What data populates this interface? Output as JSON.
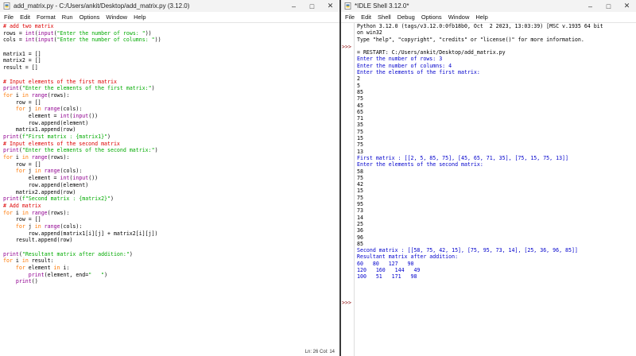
{
  "editor": {
    "title": "add_matrix.py - C:/Users/ankit/Desktop/add_matrix.py (3.12.0)",
    "menu": [
      "File",
      "Edit",
      "Format",
      "Run",
      "Options",
      "Window",
      "Help"
    ],
    "code_lines": [
      [
        [
          "cm",
          "# add two matrix"
        ]
      ],
      [
        [
          "df",
          "rows = "
        ],
        [
          "bi",
          "int"
        ],
        [
          "df",
          "("
        ],
        [
          "bi",
          "input"
        ],
        [
          "df",
          "("
        ],
        [
          "st",
          "\"Enter the number of rows: \""
        ],
        [
          "df",
          "))"
        ]
      ],
      [
        [
          "df",
          "cols = "
        ],
        [
          "bi",
          "int"
        ],
        [
          "df",
          "("
        ],
        [
          "bi",
          "input"
        ],
        [
          "df",
          "("
        ],
        [
          "st",
          "\"Enter the number of columns: \""
        ],
        [
          "df",
          "))"
        ]
      ],
      [
        [
          "df",
          ""
        ]
      ],
      [
        [
          "df",
          "matrix1 = []"
        ]
      ],
      [
        [
          "df",
          "matrix2 = []"
        ]
      ],
      [
        [
          "df",
          "result = []"
        ]
      ],
      [
        [
          "df",
          ""
        ]
      ],
      [
        [
          "cm",
          "# Input elements of the first matrix"
        ]
      ],
      [
        [
          "bi",
          "print"
        ],
        [
          "df",
          "("
        ],
        [
          "st",
          "\"Enter the elements of the first matrix:\""
        ],
        [
          "df",
          ")"
        ]
      ],
      [
        [
          "kw",
          "for"
        ],
        [
          "df",
          " i "
        ],
        [
          "kw",
          "in"
        ],
        [
          "df",
          " "
        ],
        [
          "bi",
          "range"
        ],
        [
          "df",
          "(rows):"
        ]
      ],
      [
        [
          "df",
          "    row = []"
        ]
      ],
      [
        [
          "df",
          "    "
        ],
        [
          "kw",
          "for"
        ],
        [
          "df",
          " j "
        ],
        [
          "kw",
          "in"
        ],
        [
          "df",
          " "
        ],
        [
          "bi",
          "range"
        ],
        [
          "df",
          "(cols):"
        ]
      ],
      [
        [
          "df",
          "        element = "
        ],
        [
          "bi",
          "int"
        ],
        [
          "df",
          "("
        ],
        [
          "bi",
          "input"
        ],
        [
          "df",
          "())"
        ]
      ],
      [
        [
          "df",
          "        row.append(element)"
        ]
      ],
      [
        [
          "df",
          "    matrix1.append(row)"
        ]
      ],
      [
        [
          "bi",
          "print"
        ],
        [
          "df",
          "("
        ],
        [
          "st",
          "f\"First matrix : {matrix1}\""
        ],
        [
          "df",
          ")"
        ]
      ],
      [
        [
          "cm",
          "# Input elements of the second matrix"
        ]
      ],
      [
        [
          "bi",
          "print"
        ],
        [
          "df",
          "("
        ],
        [
          "st",
          "\"Enter the elements of the second matrix:\""
        ],
        [
          "df",
          ")"
        ]
      ],
      [
        [
          "kw",
          "for"
        ],
        [
          "df",
          " i "
        ],
        [
          "kw",
          "in"
        ],
        [
          "df",
          " "
        ],
        [
          "bi",
          "range"
        ],
        [
          "df",
          "(rows):"
        ]
      ],
      [
        [
          "df",
          "    row = []"
        ]
      ],
      [
        [
          "df",
          "    "
        ],
        [
          "kw",
          "for"
        ],
        [
          "df",
          " j "
        ],
        [
          "kw",
          "in"
        ],
        [
          "df",
          " "
        ],
        [
          "bi",
          "range"
        ],
        [
          "df",
          "(cols):"
        ]
      ],
      [
        [
          "df",
          "        element = "
        ],
        [
          "bi",
          "int"
        ],
        [
          "df",
          "("
        ],
        [
          "bi",
          "input"
        ],
        [
          "df",
          "())"
        ]
      ],
      [
        [
          "df",
          "        row.append(element)"
        ]
      ],
      [
        [
          "df",
          "    matrix2.append(row)"
        ]
      ],
      [
        [
          "bi",
          "print"
        ],
        [
          "df",
          "("
        ],
        [
          "st",
          "f\"Second matrix : {matrix2}\""
        ],
        [
          "df",
          ")"
        ]
      ],
      [
        [
          "cm",
          "# Add matrix"
        ]
      ],
      [
        [
          "kw",
          "for"
        ],
        [
          "df",
          " i "
        ],
        [
          "kw",
          "in"
        ],
        [
          "df",
          " "
        ],
        [
          "bi",
          "range"
        ],
        [
          "df",
          "(rows):"
        ]
      ],
      [
        [
          "df",
          "    row = []"
        ]
      ],
      [
        [
          "df",
          "    "
        ],
        [
          "kw",
          "for"
        ],
        [
          "df",
          " j "
        ],
        [
          "kw",
          "in"
        ],
        [
          "df",
          " "
        ],
        [
          "bi",
          "range"
        ],
        [
          "df",
          "(cols):"
        ]
      ],
      [
        [
          "df",
          "        row.append(matrix1[i][j] + matrix2[i][j])"
        ]
      ],
      [
        [
          "df",
          "    result.append(row)"
        ]
      ],
      [
        [
          "df",
          ""
        ]
      ],
      [
        [
          "bi",
          "print"
        ],
        [
          "df",
          "("
        ],
        [
          "st",
          "\"Resultant matrix after addition:\""
        ],
        [
          "df",
          ")"
        ]
      ],
      [
        [
          "kw",
          "for"
        ],
        [
          "df",
          " i "
        ],
        [
          "kw",
          "in"
        ],
        [
          "df",
          " result:"
        ]
      ],
      [
        [
          "df",
          "    "
        ],
        [
          "kw",
          "for"
        ],
        [
          "df",
          " element "
        ],
        [
          "kw",
          "in"
        ],
        [
          "df",
          " i:"
        ]
      ],
      [
        [
          "df",
          "        "
        ],
        [
          "bi",
          "print"
        ],
        [
          "df",
          "(element, end="
        ],
        [
          "st",
          "\"   \""
        ],
        [
          "df",
          ")"
        ]
      ],
      [
        [
          "df",
          "    "
        ],
        [
          "bi",
          "print"
        ],
        [
          "df",
          "()"
        ]
      ]
    ],
    "status": "Ln: 26   Col: 14"
  },
  "shell": {
    "title": "*IDLE Shell 3.12.0*",
    "menu": [
      "File",
      "Edit",
      "Shell",
      "Debug",
      "Options",
      "Window",
      "Help"
    ],
    "prompts": [
      ">>>",
      ">>>"
    ],
    "lines": [
      [
        "o-std",
        "Python 3.12.0 (tags/v3.12.0:0fb18b0, Oct  2 2023, 13:03:39) [MSC v.1935 64 bit"
      ],
      [
        "o-std",
        "on win32"
      ],
      [
        "o-std",
        "Type \"help\", \"copyright\", \"credits\" or \"license()\" for more information."
      ],
      [
        "o-std",
        ""
      ],
      [
        "o-std",
        "= RESTART: C:/Users/ankit/Desktop/add_matrix.py"
      ],
      [
        "o-blue",
        "Enter the number of rows: 3"
      ],
      [
        "o-blue",
        "Enter the number of columns: 4"
      ],
      [
        "o-blue",
        "Enter the elements of the first matrix:"
      ],
      [
        "o-std",
        "2"
      ],
      [
        "o-std",
        "5"
      ],
      [
        "o-std",
        "85"
      ],
      [
        "o-std",
        "75"
      ],
      [
        "o-std",
        "45"
      ],
      [
        "o-std",
        "65"
      ],
      [
        "o-std",
        "71"
      ],
      [
        "o-std",
        "35"
      ],
      [
        "o-std",
        "75"
      ],
      [
        "o-std",
        "15"
      ],
      [
        "o-std",
        "75"
      ],
      [
        "o-std",
        "13"
      ],
      [
        "o-blue",
        "First matrix : [[2, 5, 85, 75], [45, 65, 71, 35], [75, 15, 75, 13]]"
      ],
      [
        "o-blue",
        "Enter the elements of the second matrix:"
      ],
      [
        "o-std",
        "58"
      ],
      [
        "o-std",
        "75"
      ],
      [
        "o-std",
        "42"
      ],
      [
        "o-std",
        "15"
      ],
      [
        "o-std",
        "75"
      ],
      [
        "o-std",
        "95"
      ],
      [
        "o-std",
        "73"
      ],
      [
        "o-std",
        "14"
      ],
      [
        "o-std",
        "25"
      ],
      [
        "o-std",
        "36"
      ],
      [
        "o-std",
        "96"
      ],
      [
        "o-std",
        "85"
      ],
      [
        "o-blue",
        "Second matrix : [[58, 75, 42, 15], [75, 95, 73, 14], [25, 36, 96, 85]]"
      ],
      [
        "o-blue",
        "Resultant matrix after addition:"
      ],
      [
        "o-blue",
        "60   80   127   90"
      ],
      [
        "o-blue",
        "120   160   144   49"
      ],
      [
        "o-blue",
        "100   51   171   98"
      ]
    ]
  }
}
